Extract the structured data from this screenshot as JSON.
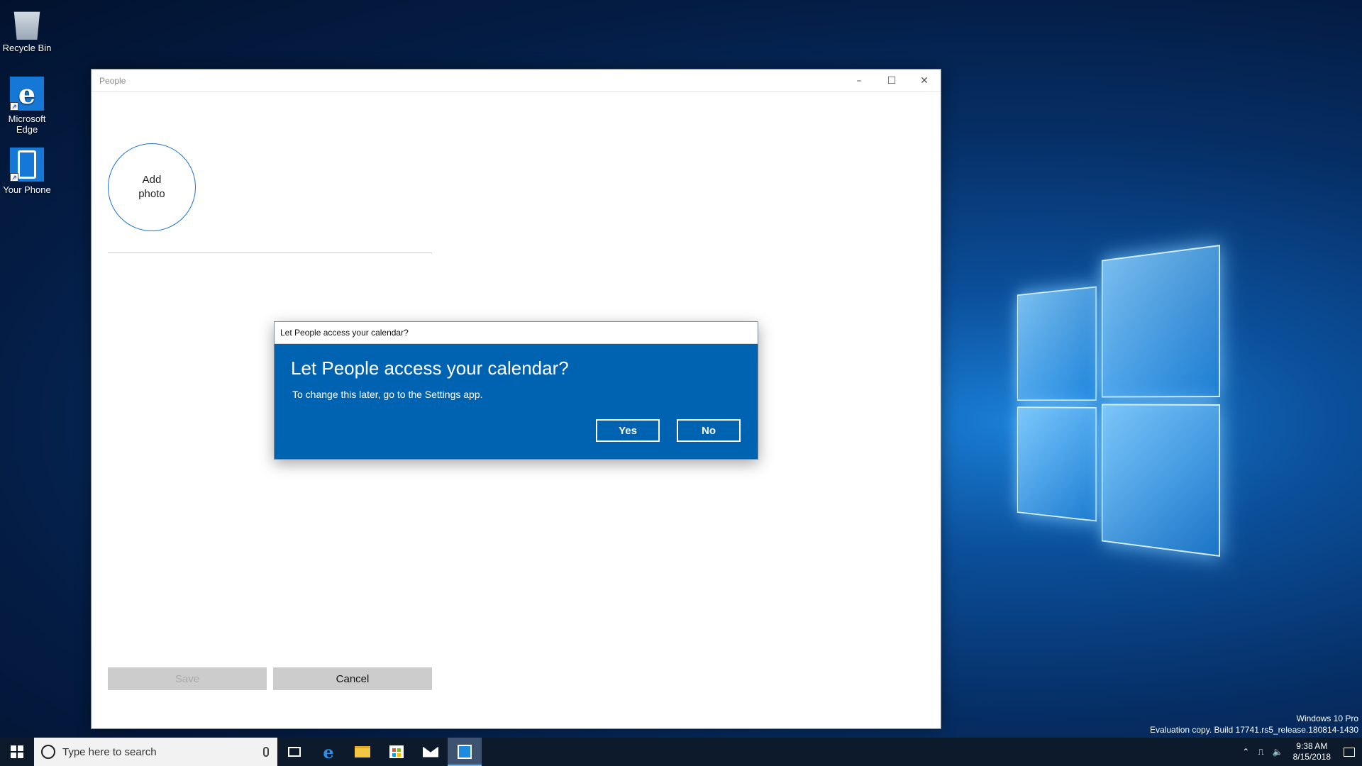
{
  "desktop": {
    "icons": [
      {
        "label": "Recycle Bin",
        "icon": "recycle-bin-icon"
      },
      {
        "label": "Microsoft Edge",
        "icon": "edge-icon"
      },
      {
        "label": "Your Phone",
        "icon": "phone-icon"
      }
    ],
    "watermark": {
      "edition": "Windows 10 Pro",
      "build": "Evaluation copy. Build 17741.rs5_release.180814-1430"
    }
  },
  "window": {
    "title": "People",
    "controls": {
      "minimize": "–",
      "maximize": "☐",
      "close": "✕"
    },
    "add_photo_label": "Add photo",
    "save_label": "Save",
    "cancel_label": "Cancel"
  },
  "dialog": {
    "window_title": "Let People access your calendar?",
    "heading": "Let People access your calendar?",
    "message": "To change this later, go to the Settings app.",
    "yes_label": "Yes",
    "no_label": "No",
    "accent_color": "#0063b1"
  },
  "taskbar": {
    "search_placeholder": "Type here to search",
    "pinned": [
      "task-view-icon",
      "edge-icon",
      "file-explorer-icon",
      "store-icon",
      "mail-icon",
      "people-icon"
    ],
    "active": "people-icon",
    "clock_time": "9:38 AM",
    "clock_date": "8/15/2018"
  }
}
